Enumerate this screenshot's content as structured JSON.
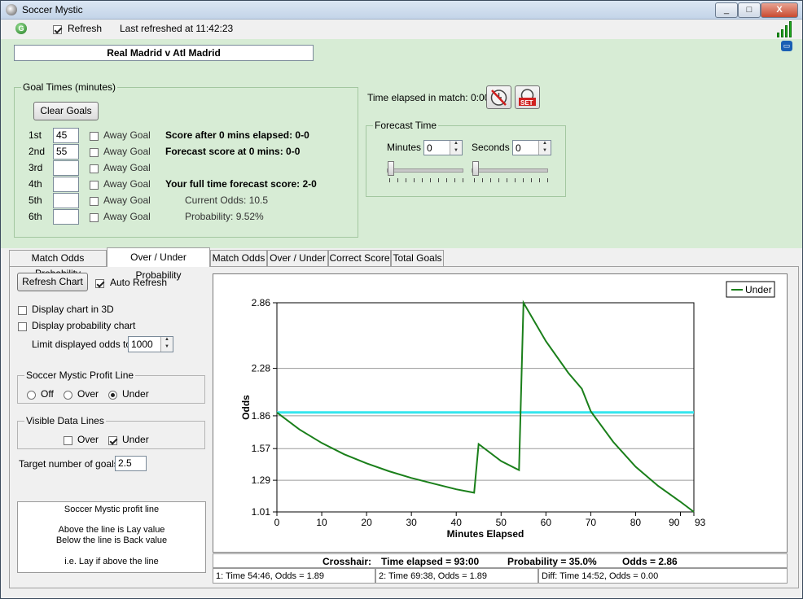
{
  "window": {
    "title": "Soccer Mystic",
    "minimize": "_",
    "maximize": "□",
    "close": "X"
  },
  "topbar": {
    "refresh_label": "Refresh",
    "last_refreshed": "Last refreshed at 11:42:23",
    "g_icon": "G"
  },
  "match": {
    "title": "Real Madrid v Atl Madrid"
  },
  "goal_times": {
    "legend": "Goal Times (minutes)",
    "clear_label": "Clear Goals",
    "away_label": "Away Goal",
    "rows": [
      {
        "ord": "1st",
        "value": "45"
      },
      {
        "ord": "2nd",
        "value": "55"
      },
      {
        "ord": "3rd",
        "value": ""
      },
      {
        "ord": "4th",
        "value": ""
      },
      {
        "ord": "5th",
        "value": ""
      },
      {
        "ord": "6th",
        "value": ""
      }
    ],
    "score_after": "Score after 0 mins elapsed: 0-0",
    "forecast_score": "Forecast score at 0 mins: 0-0",
    "full_time": "Your full time forecast score: 2-0",
    "current_odds": "Current Odds: 10.5",
    "probability": "Probability: 9.52%"
  },
  "time": {
    "elapsed": "Time elapsed in match: 0:00",
    "set_label": "SET",
    "forecast_legend": "Forecast Time",
    "minutes_label": "Minutes",
    "minutes_value": "0",
    "seconds_label": "Seconds",
    "seconds_value": "0"
  },
  "tabs": [
    "Match Odds Probability",
    "Over / Under Probability",
    "Match Odds",
    "Over / Under",
    "Correct Score",
    "Total Goals"
  ],
  "left": {
    "refresh_chart": "Refresh Chart",
    "auto_refresh": "Auto Refresh",
    "display_3d": "Display chart in 3D",
    "display_prob": "Display probability chart",
    "limit_label": "Limit displayed odds to",
    "limit_value": "1000",
    "profit_legend": "Soccer Mystic Profit Line",
    "radio_off": "Off",
    "radio_over": "Over",
    "radio_under": "Under",
    "visible_legend": "Visible Data Lines",
    "vis_over": "Over",
    "vis_under": "Under",
    "target_label": "Target number of goals",
    "target_value": "2.5",
    "note_title": "Soccer Mystic profit line",
    "note_line1": "Above the line is Lay value",
    "note_line2": "Below the line is Back value",
    "note_line3": "i.e. Lay if above the line"
  },
  "status": {
    "crosshair": "Crosshair:",
    "time_elapsed": "Time elapsed = 93:00",
    "probability": "Probability = 35.0%",
    "odds": "Odds = 2.86",
    "p1": "1:  Time 54:46, Odds = 1.89",
    "p2": "2:  Time 69:38, Odds = 1.89",
    "diff": "Diff:  Time  14:52, Odds = 0.00"
  },
  "chart_data": {
    "type": "line",
    "xlabel": "Minutes Elapsed",
    "ylabel": "Odds",
    "xlim": [
      0,
      93
    ],
    "ylim": [
      1.01,
      2.86
    ],
    "x_ticks": [
      0,
      10,
      20,
      30,
      40,
      50,
      60,
      70,
      80,
      90,
      93
    ],
    "y_ticks": [
      1.01,
      1.29,
      1.57,
      1.86,
      2.28,
      2.86
    ],
    "legend": "top-right",
    "grid": true,
    "profit_line": {
      "value": 1.89,
      "color": "#35e6ee"
    },
    "series": [
      {
        "name": "Under",
        "color": "#1a7f1a",
        "x": [
          0,
          5,
          10,
          15,
          20,
          25,
          30,
          35,
          40,
          44,
          45,
          50,
          54,
          55,
          60,
          65,
          68,
          70,
          75,
          80,
          85,
          90,
          93
        ],
        "y": [
          1.89,
          1.74,
          1.62,
          1.52,
          1.44,
          1.37,
          1.31,
          1.26,
          1.21,
          1.18,
          1.61,
          1.46,
          1.38,
          2.86,
          2.52,
          2.24,
          2.1,
          1.9,
          1.63,
          1.41,
          1.24,
          1.1,
          1.01
        ]
      }
    ]
  }
}
